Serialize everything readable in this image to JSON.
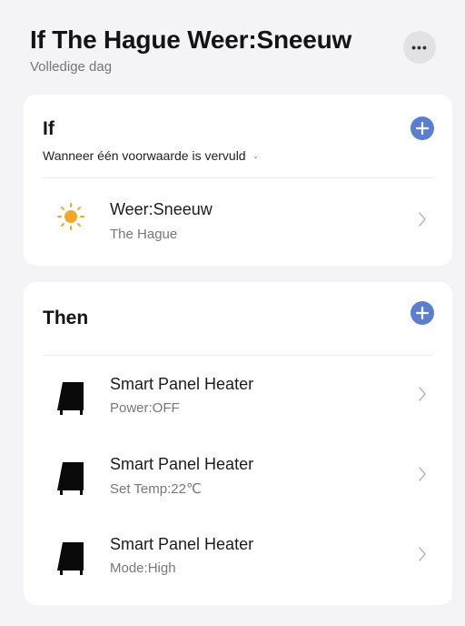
{
  "header": {
    "title": "If The Hague Weer:Sneeuw",
    "subtitle": "Volledige dag",
    "more_icon": "more-horizontal-icon"
  },
  "if_section": {
    "title": "If",
    "condition_mode": "Wanneer één voorwaarde is vervuld",
    "add_icon": "plus-circle-icon",
    "conditions": [
      {
        "icon": "sun-icon",
        "title": "Weer:Sneeuw",
        "subtitle": "The Hague"
      }
    ]
  },
  "then_section": {
    "title": "Then",
    "add_icon": "plus-circle-icon",
    "actions": [
      {
        "icon": "panel-heater-icon",
        "title": "Smart Panel Heater",
        "subtitle": "Power:OFF"
      },
      {
        "icon": "panel-heater-icon",
        "title": "Smart Panel Heater",
        "subtitle": "Set Temp:22℃"
      },
      {
        "icon": "panel-heater-icon",
        "title": "Smart Panel Heater",
        "subtitle": "Mode:High"
      }
    ]
  },
  "colors": {
    "background": "#f4f4f6",
    "card": "#ffffff",
    "accent": "#5a7fd1",
    "sun": "#f6a623"
  }
}
